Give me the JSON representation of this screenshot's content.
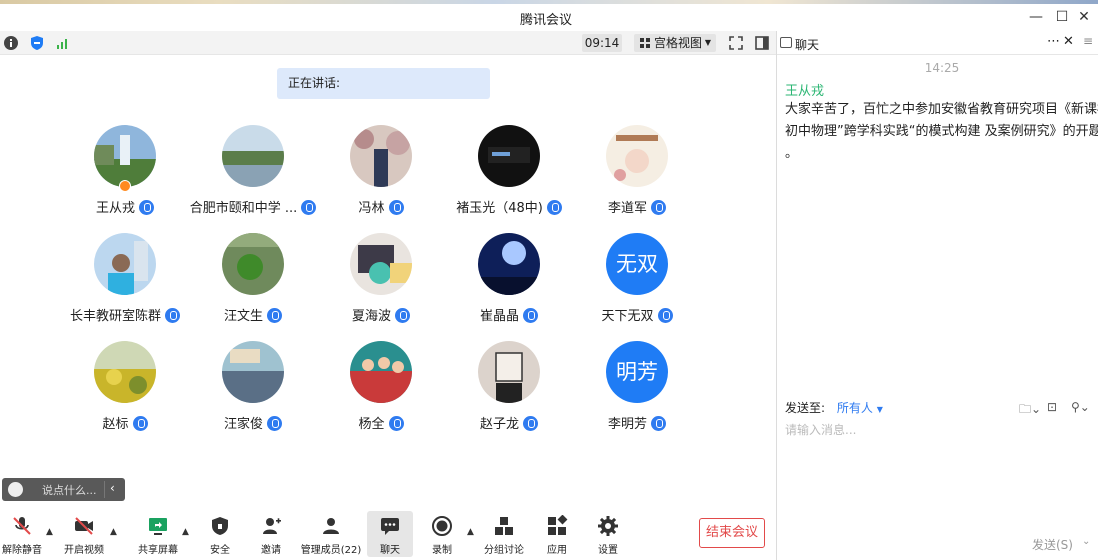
{
  "window": {
    "title": "腾讯会议",
    "min": "—",
    "max": "☐",
    "close": "✕"
  },
  "status": {
    "time": "09:14",
    "view_label": "宫格视图"
  },
  "speaking": {
    "label": "正在讲话:"
  },
  "participants": [
    {
      "name": "王从戎",
      "host": true
    },
    {
      "name": "合肥市颐和中学 ..."
    },
    {
      "name": "冯林"
    },
    {
      "name": "褚玉光（48中)"
    },
    {
      "name": "李道军"
    },
    {
      "name": "长丰教研室陈群"
    },
    {
      "name": "汪文生"
    },
    {
      "name": "夏海波"
    },
    {
      "name": "崔晶晶"
    },
    {
      "name": "天下无双",
      "avatar_text": "无双"
    },
    {
      "name": "赵标"
    },
    {
      "name": "汪家俊"
    },
    {
      "name": "杨全"
    },
    {
      "name": "赵子龙"
    },
    {
      "name": "李明芳",
      "avatar_text": "明芳"
    }
  ],
  "quick_chat": {
    "placeholder": "说点什么..."
  },
  "toolbar": {
    "unmute": "解除静音",
    "video": "开启视频",
    "share": "共享屏幕",
    "security": "安全",
    "invite": "邀请",
    "members": "管理成员(22)",
    "chat": "聊天",
    "record": "录制",
    "breakout": "分组讨论",
    "apps": "应用",
    "settings": "设置",
    "end": "结束会议"
  },
  "chat": {
    "title": "聊天",
    "time": "14:25",
    "sender": "王从戎",
    "lines": [
      "大家辛苦了，百忙之中参加安徽省教育研究项目《新课标下",
      "初中物理”跨学科实践“的模式构建 及案例研究》的开题",
      "。"
    ],
    "send_to_label": "发送至:",
    "send_to_value": "所有人",
    "input_placeholder": "请输入消息...",
    "send_label": "发送(S)"
  },
  "colors": {
    "accent": "#1f7cf5",
    "end": "#e24a4a",
    "sender": "#2bb673"
  }
}
